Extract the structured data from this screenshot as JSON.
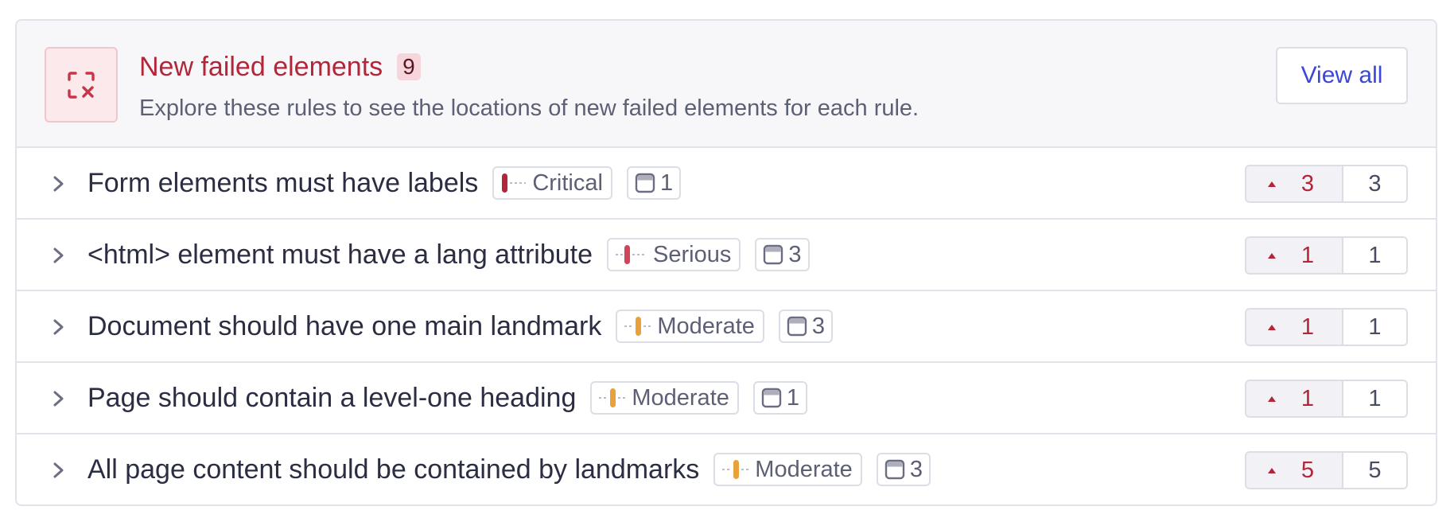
{
  "header": {
    "title": "New failed elements",
    "count": "9",
    "subtitle": "Explore these rules to see the locations of new failed elements for each rule.",
    "view_all_label": "View all",
    "icon": "failed-elements-icon"
  },
  "colors": {
    "critical": "#b3263a",
    "serious": "#d04557",
    "moderate": "#e9a23b",
    "accent": "#3b47d6",
    "border": "#e1e3ea"
  },
  "rules": [
    {
      "title": "Form elements must have labels",
      "severity": "Critical",
      "pages": "1",
      "new": "3",
      "total": "3"
    },
    {
      "title": "<html> element must have a lang attribute",
      "severity": "Serious",
      "pages": "3",
      "new": "1",
      "total": "1"
    },
    {
      "title": "Document should have one main landmark",
      "severity": "Moderate",
      "pages": "3",
      "new": "1",
      "total": "1"
    },
    {
      "title": "Page should contain a level-one heading",
      "severity": "Moderate",
      "pages": "1",
      "new": "1",
      "total": "1"
    },
    {
      "title": "All page content should be contained by landmarks",
      "severity": "Moderate",
      "pages": "3",
      "new": "5",
      "total": "5"
    }
  ]
}
